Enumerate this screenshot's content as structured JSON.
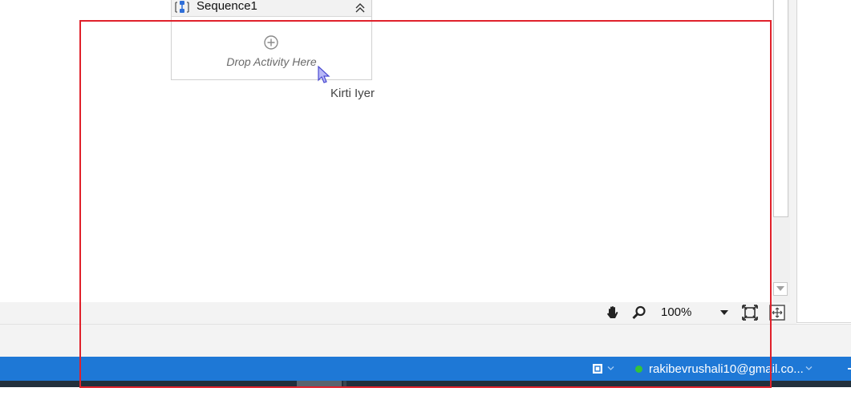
{
  "designer": {
    "sequence": {
      "title": "Sequence1",
      "icon": "sequence-icon",
      "collapse_icon": "double-chevron-up-icon",
      "drop_placeholder": "Drop Activity Here",
      "add_icon": "plus-circle-icon"
    },
    "cursor_user_label": "Kirti Iyer"
  },
  "toolbar": {
    "pan_icon": "hand-icon",
    "zoom_icon": "magnifier-icon",
    "zoom_value": "100%",
    "fit_icon": "fit-to-screen-icon",
    "overview_icon": "overview-icon"
  },
  "status_bar": {
    "account": "rakibevrushali10@gmail.co...",
    "online_color": "#34c33a",
    "background_color": "#1e78d6"
  },
  "highlight_color": "#e0212b"
}
